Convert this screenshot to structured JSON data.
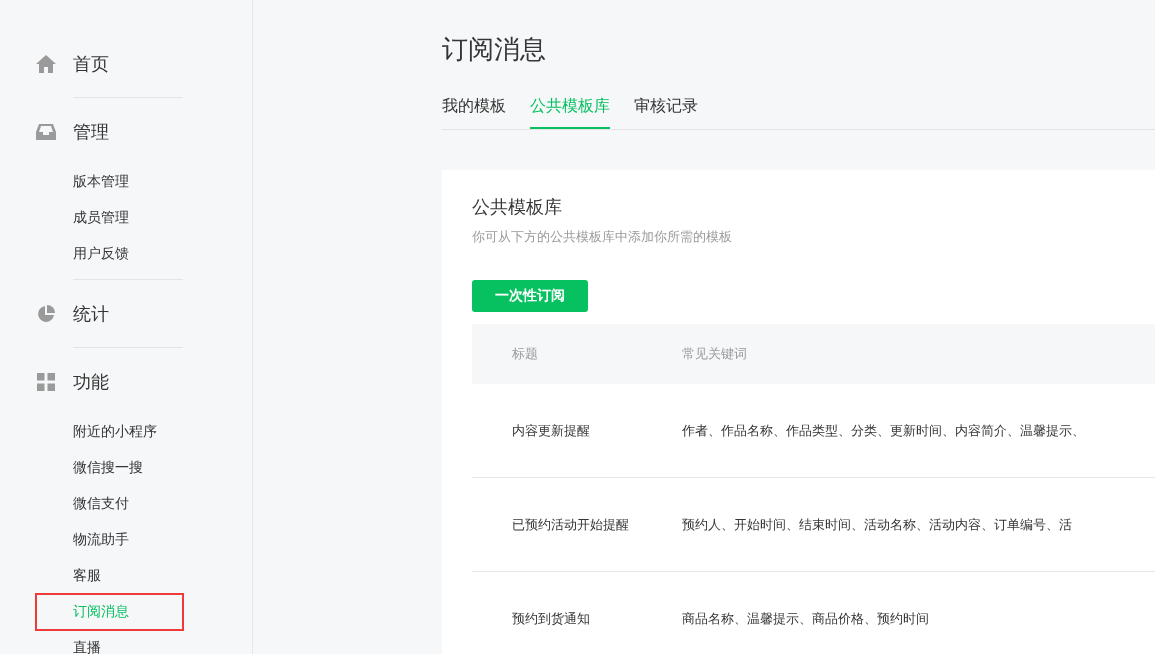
{
  "sidebar": {
    "sections": [
      {
        "kind": "home",
        "label": "首页"
      },
      {
        "kind": "inbox",
        "label": "管理",
        "items": [
          {
            "label": "版本管理",
            "selected": false,
            "highlighted": false
          },
          {
            "label": "成员管理",
            "selected": false,
            "highlighted": false
          },
          {
            "label": "用户反馈",
            "selected": false,
            "highlighted": false
          }
        ]
      },
      {
        "kind": "pie",
        "label": "统计"
      },
      {
        "kind": "grid",
        "label": "功能",
        "items": [
          {
            "label": "附近的小程序",
            "selected": false,
            "highlighted": false
          },
          {
            "label": "微信搜一搜",
            "selected": false,
            "highlighted": false
          },
          {
            "label": "微信支付",
            "selected": false,
            "highlighted": false
          },
          {
            "label": "物流助手",
            "selected": false,
            "highlighted": false
          },
          {
            "label": "客服",
            "selected": false,
            "highlighted": false
          },
          {
            "label": "订阅消息",
            "selected": true,
            "highlighted": true
          },
          {
            "label": "直播",
            "selected": false,
            "highlighted": false
          }
        ]
      }
    ]
  },
  "page": {
    "title": "订阅消息",
    "tabs": [
      {
        "label": "我的模板",
        "selected": false
      },
      {
        "label": "公共模板库",
        "selected": true
      },
      {
        "label": "审核记录",
        "selected": false
      }
    ],
    "card": {
      "title": "公共模板库",
      "description": "你可从下方的公共模板库中添加你所需的模板",
      "button": "一次性订阅",
      "table": {
        "columns": [
          "标题",
          "常见关键词"
        ],
        "rows": [
          {
            "title": "内容更新提醒",
            "keywords": "作者、作品名称、作品类型、分类、更新时间、内容简介、温馨提示、"
          },
          {
            "title": "已预约活动开始提醒",
            "keywords": "预约人、开始时间、结束时间、活动名称、活动内容、订单编号、活"
          },
          {
            "title": "预约到货通知",
            "keywords": "商品名称、温馨提示、商品价格、预约时间"
          }
        ]
      }
    }
  }
}
